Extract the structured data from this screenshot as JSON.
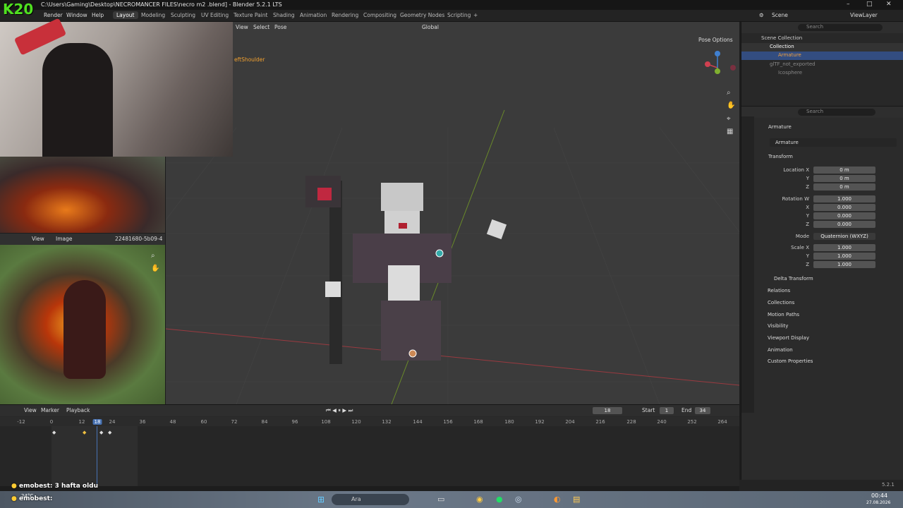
{
  "window": {
    "title": "C:\\Users\\Gaming\\Desktop\\NECROMANCER FILES\\necro m2 .blend] - Blender 5.2.1 LTS",
    "min": "–",
    "max": "□",
    "close": "✕"
  },
  "overlay_logo": "K20",
  "menus": [
    "Render",
    "Window",
    "Help"
  ],
  "workspaces": [
    "Layout",
    "Modeling",
    "Sculpting",
    "UV Editing",
    "Texture Paint",
    "Shading",
    "Animation",
    "Rendering",
    "Compositing",
    "Geometry Nodes",
    "Scripting",
    "+"
  ],
  "active_workspace": "Layout",
  "scene": {
    "label": "Scene",
    "view_layer": "ViewLayer"
  },
  "viewport": {
    "menus": [
      "View",
      "Select",
      "Pose"
    ],
    "orientation": "Global",
    "pose_options": "Pose Options",
    "bone_label": "eftShoulder"
  },
  "image_editor": {
    "menus": [
      "View",
      "Image"
    ],
    "image_name": "22481680-5b09-4"
  },
  "outliner": {
    "search_placeholder": "Search",
    "rows": [
      {
        "label": "Scene Collection"
      },
      {
        "label": "Collection"
      },
      {
        "label": "Armature",
        "selected": true
      },
      {
        "label": "glTF_not_exported"
      },
      {
        "label": "Icosphere"
      }
    ]
  },
  "properties": {
    "search_placeholder": "Search",
    "object_name": "Armature",
    "data_name": "Armature",
    "transform_label": "Transform",
    "location": {
      "label": "Location X",
      "x": "0 m",
      "y": "0 m",
      "z": "0 m"
    },
    "rotation": {
      "label": "Rotation W",
      "w": "1.000",
      "x": "0.000",
      "y": "0.000",
      "z": "0.000"
    },
    "mode": {
      "label": "Mode",
      "value": "Quaternion (WXYZ)"
    },
    "scale": {
      "label": "Scale X",
      "x": "1.000",
      "y": "1.000",
      "z": "1.000"
    },
    "axis_y": "Y",
    "axis_z": "Z",
    "axis_x": "X",
    "delta": "Delta Transform",
    "sections": [
      "Relations",
      "Collections",
      "Motion Paths",
      "Visibility",
      "Viewport Display",
      "Animation",
      "Custom Properties"
    ]
  },
  "timeline": {
    "menus": [
      "View",
      "Marker",
      "Playback"
    ],
    "current_frame": "18",
    "start_label": "Start",
    "start": "1",
    "end_label": "End",
    "end": "34",
    "ticks": [
      "-12",
      "0",
      "12",
      "18",
      "24",
      "36",
      "48",
      "60",
      "72",
      "84",
      "96",
      "108",
      "120",
      "132",
      "144",
      "156",
      "168",
      "180",
      "192",
      "204",
      "216",
      "228",
      "240",
      "252",
      "264"
    ]
  },
  "chat": [
    {
      "user": "emobest",
      "text": ": 3 hafta oldu"
    },
    {
      "user": "emobest",
      "text": ":"
    }
  ],
  "status": {
    "version": "5.2.1"
  },
  "taskbar": {
    "search": "Ara",
    "time": "00:44",
    "date": "27.08.2026",
    "temp": "24°C"
  }
}
